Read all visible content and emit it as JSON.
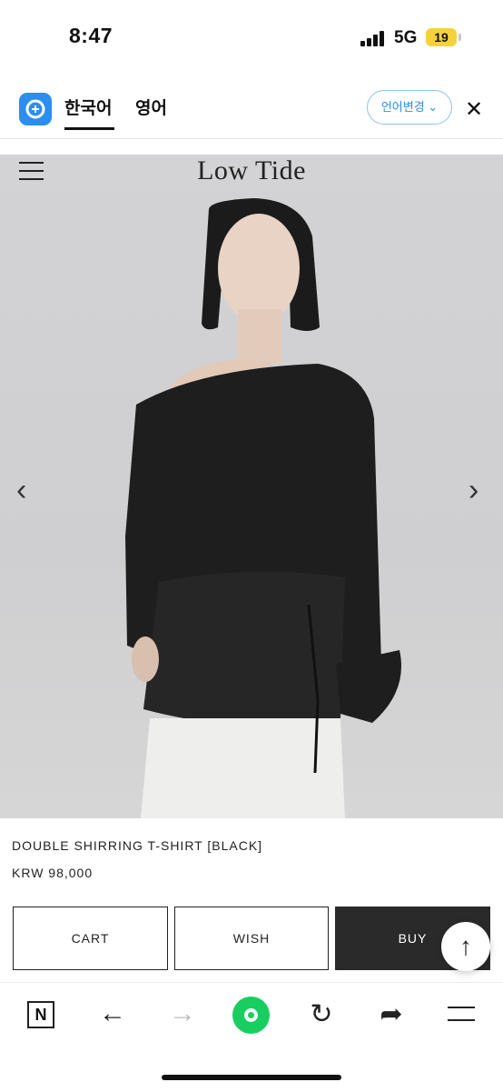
{
  "status_bar": {
    "time": "8:47",
    "network": "5G",
    "battery": "19"
  },
  "translate_bar": {
    "tabs": [
      {
        "label": "한국어",
        "active": true
      },
      {
        "label": "영어",
        "active": false
      }
    ],
    "language_button": "언어변경",
    "close_icon": "close-icon",
    "accent_color": "#2b8ef0"
  },
  "header": {
    "brand": "Low Tide",
    "menu_icon": "hamburger-icon"
  },
  "gallery": {
    "prev_icon": "chevron-left-icon",
    "next_icon": "chevron-right-icon"
  },
  "product": {
    "name": "DOUBLE SHIRRING T-SHIRT [BLACK]",
    "price": "KRW 98,000"
  },
  "actions": {
    "cart": "CART",
    "wish": "WISH",
    "buy": "BUY"
  },
  "browser_nav": {
    "items": [
      "naver-n-icon",
      "back-arrow-icon",
      "forward-arrow-icon",
      "home-dot-icon",
      "reload-icon",
      "share-icon",
      "menu-icon"
    ]
  }
}
